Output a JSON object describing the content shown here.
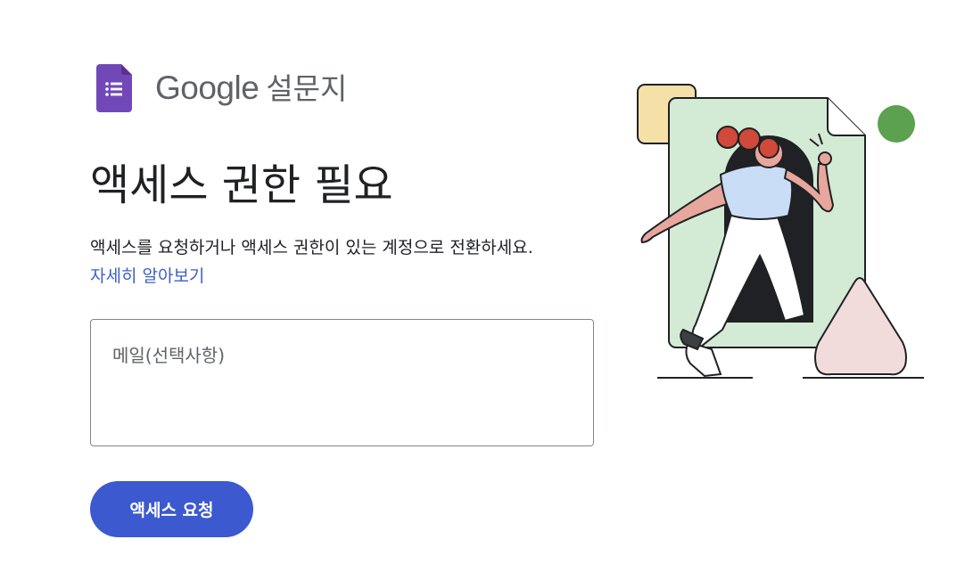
{
  "header": {
    "brand_google": "Google",
    "brand_product": "설문지",
    "icon": "google-forms-icon"
  },
  "main": {
    "title": "액세스 권한 필요",
    "description": "액세스를 요청하거나 액세스 권한이 있는 계정으로 전환하세요.",
    "learn_more": "자세히 알아보기",
    "email_placeholder": "메일(선택사항)",
    "email_value": "",
    "request_button": "액세스 요청"
  },
  "colors": {
    "accent": "#3c59cf",
    "link": "#3b5fc8",
    "forms_purple": "#7248b9"
  },
  "illustration": {
    "subject": "person-stepping-through-document-doorway-illustration"
  }
}
